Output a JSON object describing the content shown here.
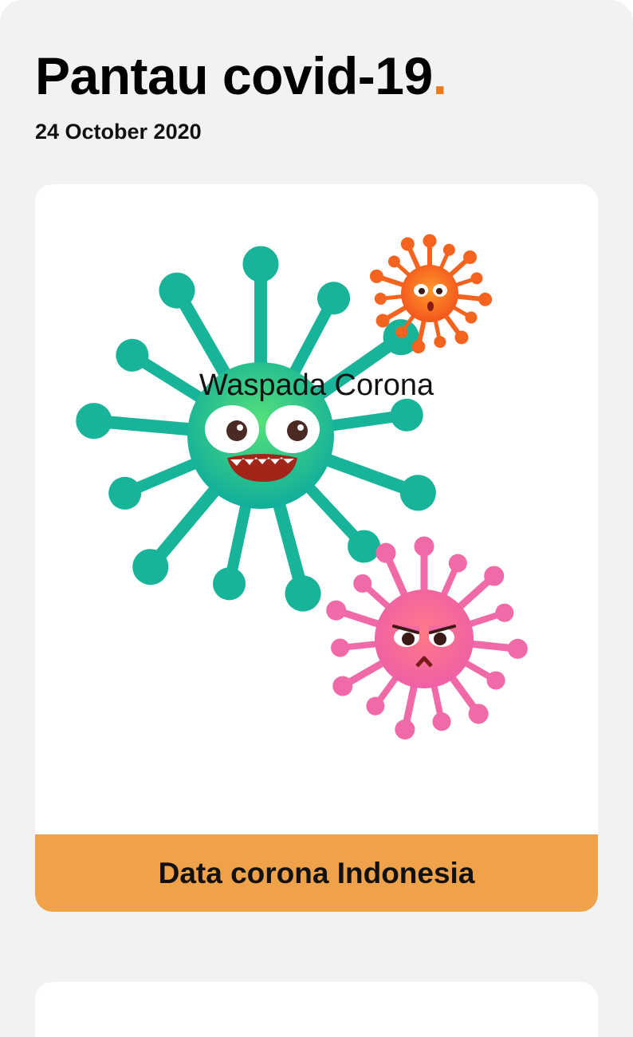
{
  "header": {
    "title": "Pantau covid-19",
    "title_dot": ".",
    "date": "24 October 2020"
  },
  "card": {
    "illustration": "virus-illustration",
    "caption": "Waspada Corona",
    "button_label": "Data corona Indonesia"
  },
  "colors": {
    "accent": "#f07a1a",
    "button": "#efa24a",
    "background": "#f2f2f2",
    "virus_green": "#1fb99a",
    "virus_orange": "#f5641e",
    "virus_pink": "#f06aa8"
  }
}
